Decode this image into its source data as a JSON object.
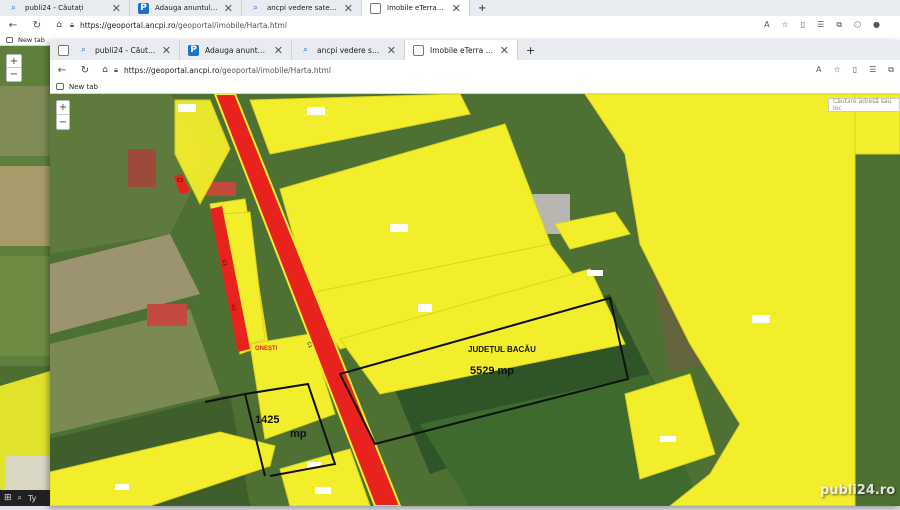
{
  "outer_browser": {
    "tabs": [
      {
        "label": "publi24 - Căutați",
        "icon": "search-icon",
        "active": false
      },
      {
        "label": "Adauga anuntul tau - Publi24",
        "icon": "publi24-logo-icon",
        "active": false
      },
      {
        "label": "ancpi vedere satelit - Căutați",
        "icon": "search-icon",
        "active": false
      },
      {
        "label": "Imobile eTerra - Public",
        "icon": "page-icon",
        "active": true
      }
    ],
    "new_tab": "+",
    "address": {
      "host": "https://geoportal.ancpi.ro",
      "path": "/geoportal/imobile/Harta.html"
    },
    "favorites": {
      "new_tab_label": "New tab"
    }
  },
  "inner_browser": {
    "tabs": [
      {
        "label": "publi24 - Căutați",
        "icon": "search-icon",
        "active": false
      },
      {
        "label": "Adauga anuntul tau - Publi24",
        "icon": "publi24-logo-icon",
        "active": false
      },
      {
        "label": "ancpi vedere satelit - Căutați",
        "icon": "search-icon",
        "active": false
      },
      {
        "label": "Imobile eTerra - Public",
        "icon": "page-icon",
        "active": true
      }
    ],
    "new_tab": "+",
    "address": {
      "host": "https://geoportal.ancpi.ro",
      "path": "/geoportal/imobile/Harta.html"
    },
    "favorites": {
      "new_tab_label": "New tab"
    }
  },
  "map": {
    "search_placeholder": "Căutare adresă sau loc",
    "zoom_in": "+",
    "zoom_out": "−",
    "labels": {
      "county": "JUDEȚUL BACĂU",
      "area_large": "5529 mp",
      "area_small_value": "1425",
      "area_small_unit": "mp",
      "locality": "ONEȘTI",
      "road_codes": [
        "C1",
        "C1",
        "C1",
        "C1"
      ],
      "road_code_main": "C1"
    }
  },
  "watermark": {
    "text": "publi24.ro"
  },
  "taskbar": {
    "search_hint": "Ty"
  },
  "colors": {
    "parcel_yellow": "#f2ee2c",
    "road_red": "#e8231d",
    "field_green": "#5d8a3a",
    "boundary_black": "#111111"
  }
}
